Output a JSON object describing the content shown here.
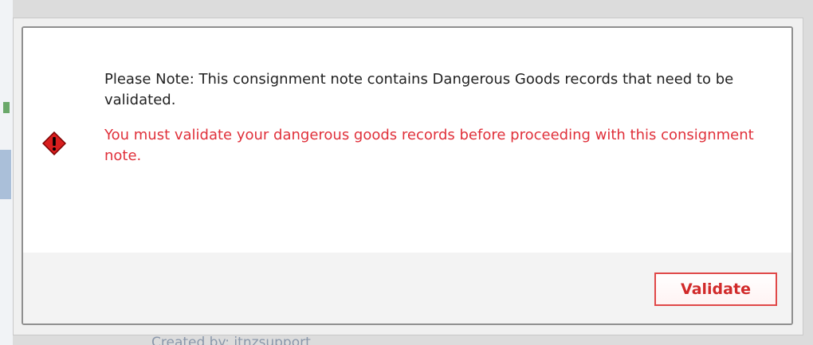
{
  "dialog": {
    "note": "Please Note: This consignment note contains Dangerous Goods records that need to be validated.",
    "warning": "You must validate your dangerous goods records before proceeding with this consignment note.",
    "icon": "warning-diamond-icon",
    "validate_label": "Validate"
  },
  "background": {
    "footer_text": "Created by: itnzsupport"
  },
  "colors": {
    "warning_text": "#e0303a",
    "button_border": "#e04848",
    "icon_red": "#d81e1e"
  }
}
